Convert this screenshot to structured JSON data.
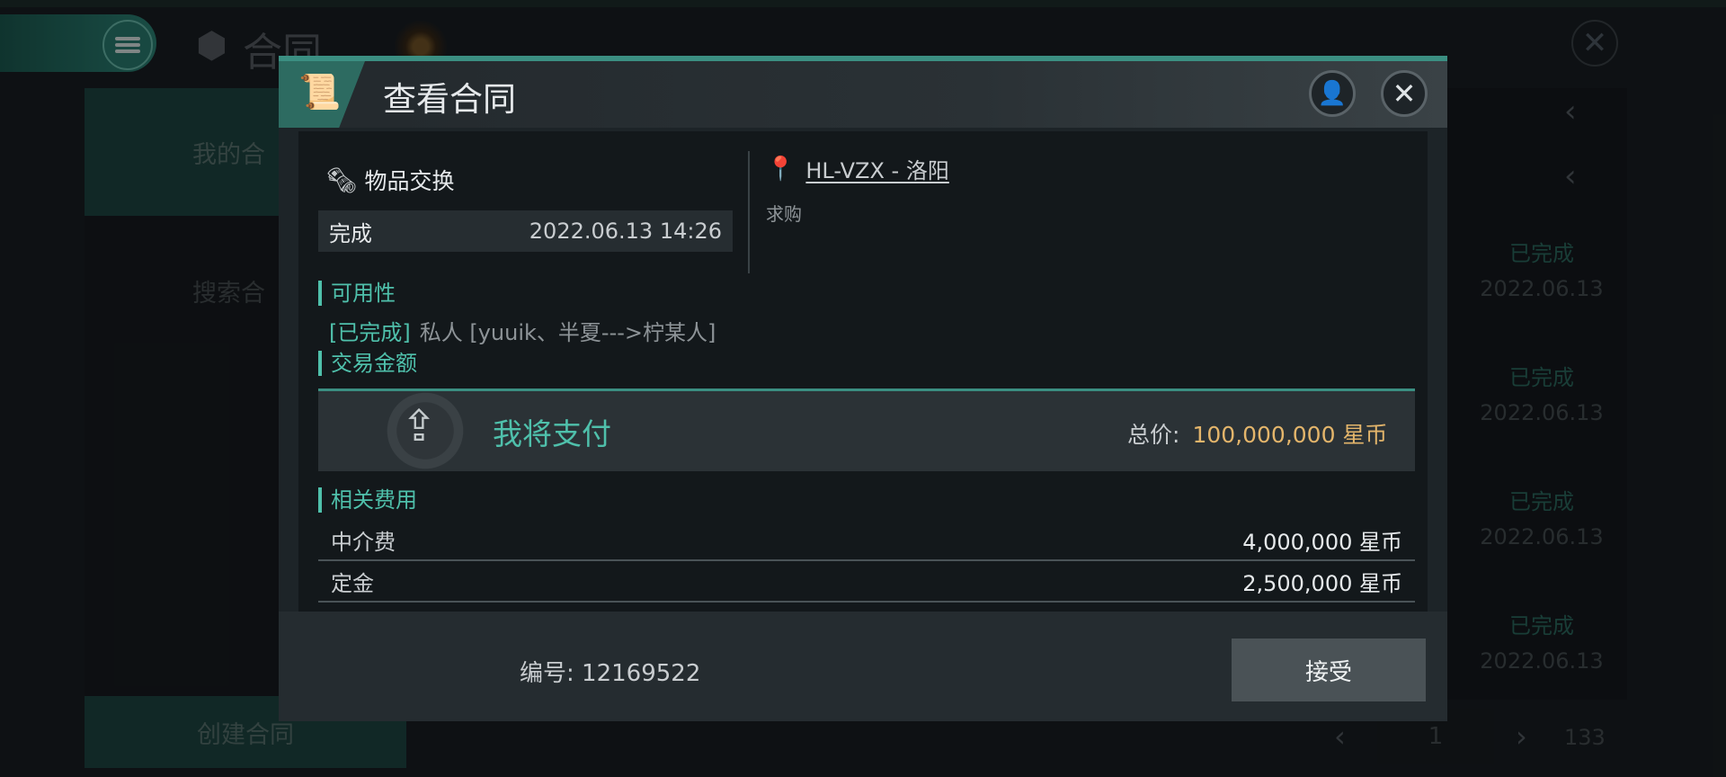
{
  "background": {
    "title": "合同",
    "left_nav": [
      {
        "label": "我的合",
        "active": true
      },
      {
        "label": "搜索合",
        "active": false
      }
    ],
    "create_label": "创建合同",
    "rows": [
      {
        "status": "已完成",
        "date": "2022.06.13"
      },
      {
        "status": "已完成",
        "date": "2022.06.13"
      },
      {
        "status": "已完成",
        "date": "2022.06.13"
      },
      {
        "status": "已完成",
        "date": "2022.06.13"
      }
    ],
    "pager": {
      "page": "1",
      "total": "133"
    }
  },
  "modal": {
    "title": "查看合同",
    "trade_type": "物品交换",
    "status": "完成",
    "timestamp": "2022.06.13 14:26",
    "location": "HL-VZX - 洛阳",
    "location_type": "求购",
    "availability_title": "可用性",
    "availability_status": "[已完成]",
    "availability_text": "私人 [yuuik、半夏--->柠某人]",
    "amount_title": "交易金额",
    "pay_label": "我将支付",
    "total_label": "总价:",
    "total_amount": "100,000,000 星币",
    "fees_title": "相关费用",
    "fees": [
      {
        "label": "中介费",
        "value": "4,000,000 星币"
      },
      {
        "label": "定金",
        "value": "2,500,000 星币"
      }
    ],
    "serial": "编号: 12169522",
    "accept_label": "接受"
  },
  "colors": {
    "accent": "#4fc0ab",
    "gold": "#e3b56b",
    "panel": "#1d2428"
  }
}
